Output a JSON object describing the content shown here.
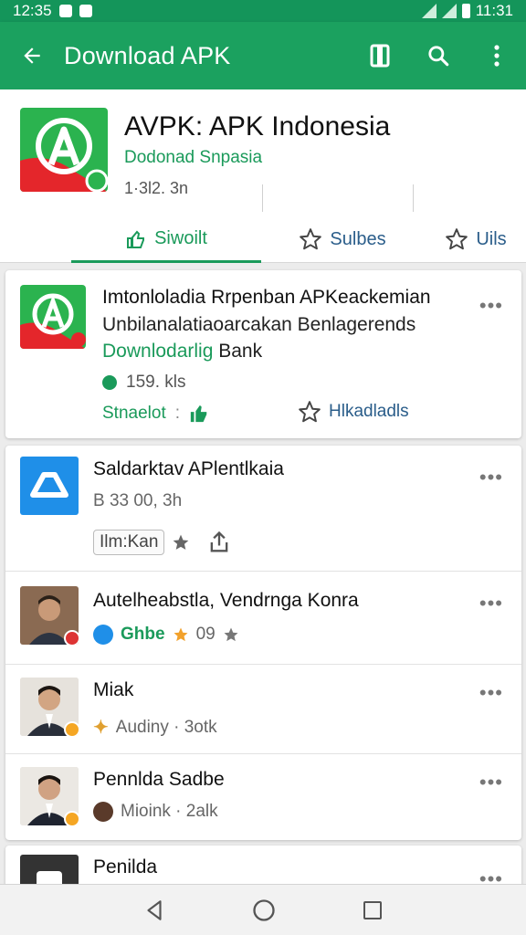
{
  "status_bar": {
    "time": "12:35",
    "right_text": "11:31"
  },
  "app_bar": {
    "title": "Download APK"
  },
  "header": {
    "app_name": "AVPK: APK Indonesia",
    "developer": "Dodonad Snpasia",
    "meta": "1·3l2. 3n",
    "tabs": [
      {
        "label": "Siwoilt"
      },
      {
        "label": "Sulbes"
      },
      {
        "label": "Uils"
      }
    ]
  },
  "featured": {
    "line1": "Imtonloladia Rrpenban APKeackemian",
    "line2": "Unbilanalatiaoarcakan Benlagerends",
    "line3_green": "Downlodarlig",
    "line3_rest": " Bank",
    "stat": "159. kls",
    "action1": "Stnaelot",
    "action2": "Hlkadladls"
  },
  "list": {
    "items": [
      {
        "title": "Saldarktav APlentlkaia",
        "sub": "B 33 00, 3h",
        "chip": "Ilm:Kan"
      },
      {
        "title": "Autelheabstla, Vendrnga Konra",
        "sub_green": "Ghbe",
        "sub": "09"
      },
      {
        "title": "Miak",
        "sub": "Audiny · 3otk"
      },
      {
        "title": "Pennlda Sadbe",
        "sub": "Mioink · 2alk"
      }
    ]
  },
  "last_card": {
    "title": "Penilda"
  },
  "colors": {
    "primary": "#1ba15f",
    "status": "#14955a",
    "link": "#2a5d8a"
  }
}
